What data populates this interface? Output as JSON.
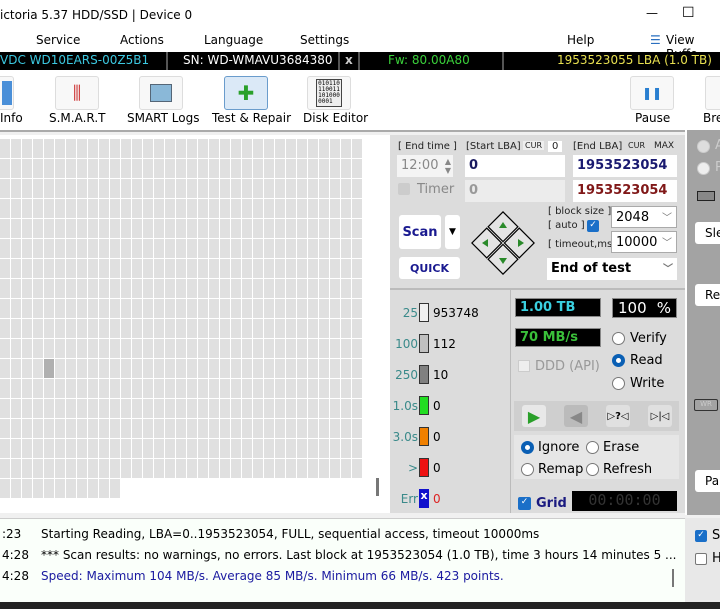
{
  "window": {
    "title": "ictoria 5.37 HDD/SSD | Device 0",
    "minimize": "—",
    "maximize": "☐"
  },
  "menu": {
    "items": [
      "Service",
      "Actions",
      "Language",
      "Settings",
      "Help"
    ],
    "view_buffer": "View Buffe"
  },
  "device": {
    "model": "VDC WD10EARS-00Z5B1",
    "serial": "SN: WD-WMAVU3684380",
    "close": "x",
    "firmware": "Fw: 80.00A80",
    "capacity": "1953523055 LBA (1.0 TB)"
  },
  "toolbar": {
    "info": "Info",
    "smart": "S.M.A.R.T",
    "smart_logs": "SMART Logs",
    "test_repair": "Test & Repair",
    "disk_editor": "Disk Editor",
    "pause": "Pause",
    "break": "Bre"
  },
  "test": {
    "end_time_label": "[ End time ]",
    "end_time": "12:00",
    "start_lba_label": "[Start LBA]",
    "cur": "CUR",
    "start_cur_value": "0",
    "start_lba": "0",
    "start_lba2": "0",
    "end_lba_label": "[End LBA]",
    "max": "MAX",
    "end_lba": "1953523054",
    "end_lba2": "1953523054",
    "timer": "Timer",
    "scan": "Scan",
    "quick": "QUICK",
    "block_size_label": "[ block size ]",
    "auto_label": "[ auto ]",
    "block_size": "2048",
    "timeout_label": "[ timeout,ms ]",
    "timeout": "10000",
    "end_action": "End of test"
  },
  "legend": [
    {
      "label": "25",
      "count": "953748",
      "color": "#f0f0f0"
    },
    {
      "label": "100",
      "count": "112",
      "color": "#c0c0c0"
    },
    {
      "label": "250",
      "count": "10",
      "color": "#808080"
    },
    {
      "label": "1.0s",
      "count": "0",
      "color": "#22dd22"
    },
    {
      "label": "3.0s",
      "count": "0",
      "color": "#f08000"
    },
    {
      "label": ">",
      "count": "0",
      "color": "#ee1111"
    },
    {
      "label": "Err",
      "count": "0",
      "color": "#1010cc"
    }
  ],
  "status": {
    "size": "1.00 TB",
    "percent": "100",
    "pct_sign": "%",
    "speed": "70 MB/s",
    "ddd": "DDD (API)",
    "verify": "Verify",
    "read": "Read",
    "write": "Write",
    "mode": "Read",
    "ignore": "Ignore",
    "erase": "Erase",
    "remap": "Remap",
    "refresh": "Refresh",
    "repair_mode": "Ignore",
    "grid": "Grid",
    "timer": "00:00:00"
  },
  "right_panel": {
    "b1": "Sle",
    "b2": "Re",
    "b3": "Pa",
    "wr": "WR",
    "r1": "A",
    "r2": "P"
  },
  "log": [
    {
      "time": ":23",
      "text": "Starting Reading, LBA=0..1953523054, FULL, sequential access, timeout 10000ms",
      "color": "#000000"
    },
    {
      "time": "4:28",
      "text": "*** Scan results: no warnings, no errors. Last block at 1953523054 (1.0 TB), time 3 hours 14 minutes 5 ...",
      "color": "#000000"
    },
    {
      "time": "4:28",
      "text": "Speed: Maximum 104 MB/s. Average 85 MB/s. Minimum 66 MB/s. 423 points.",
      "color": "#1a1aa0"
    }
  ],
  "log_side": {
    "c1": "S",
    "c2": "H"
  }
}
